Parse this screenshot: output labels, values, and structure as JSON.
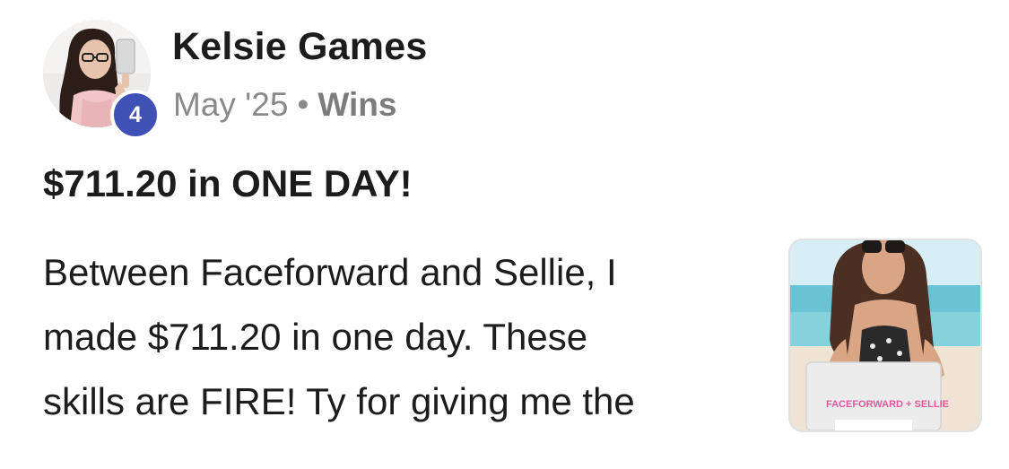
{
  "post": {
    "author": {
      "name": "Kelsie Games",
      "level": "4"
    },
    "meta": {
      "date": "May '25",
      "separator": "•",
      "category": "Wins"
    },
    "title": "$711.20 in ONE DAY!",
    "body_lines": [
      "Between Faceforward and Sellie, I",
      "made $711.20 in one day. These",
      "skills are FIRE! Ty for giving me the"
    ],
    "thumbnail": {
      "laptop_text": "FACEFORWARD + SELLIE"
    }
  },
  "colors": {
    "badge": "#3f51b5",
    "text": "#1c1c1c",
    "meta": "#8a8a8a",
    "laptop_text": "#e05a9a"
  },
  "icons": {
    "avatar": "user-photo",
    "thumbnail": "post-image"
  }
}
